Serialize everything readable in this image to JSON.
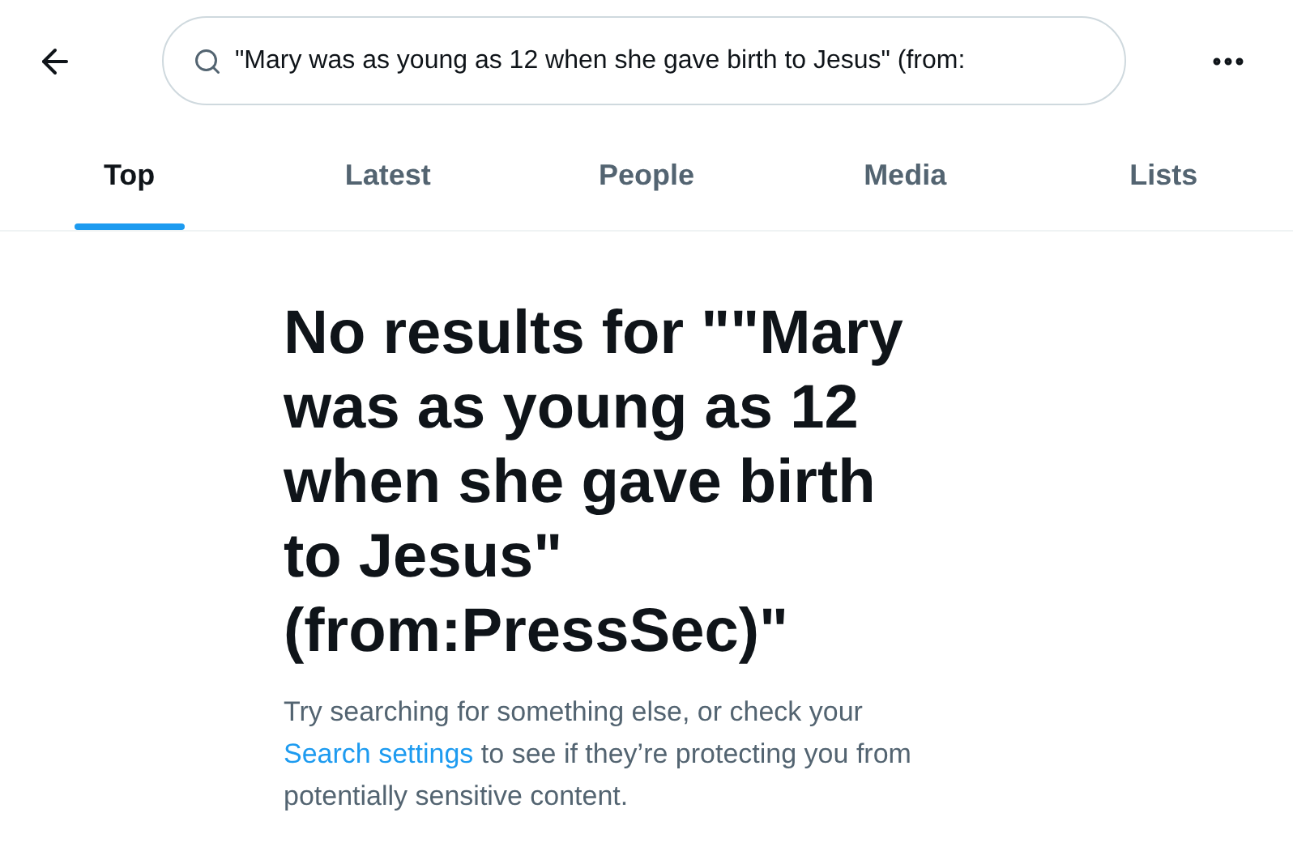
{
  "search": {
    "value": "\"Mary was as young as 12 when she gave birth to Jesus\" (from:"
  },
  "tabs": [
    {
      "label": "Top",
      "selected": true
    },
    {
      "label": "Latest",
      "selected": false
    },
    {
      "label": "People",
      "selected": false
    },
    {
      "label": "Media",
      "selected": false
    },
    {
      "label": "Lists",
      "selected": false
    }
  ],
  "empty_state": {
    "title": "No results for \"\"Mary was as young as 12 when she gave birth to Jesus\" (from:PressSec)\"",
    "text_before": "Try searching for something else, or check your",
    "link": "Search settings",
    "text_after": "to see if they’re protecting you from potentially sensitive content."
  }
}
